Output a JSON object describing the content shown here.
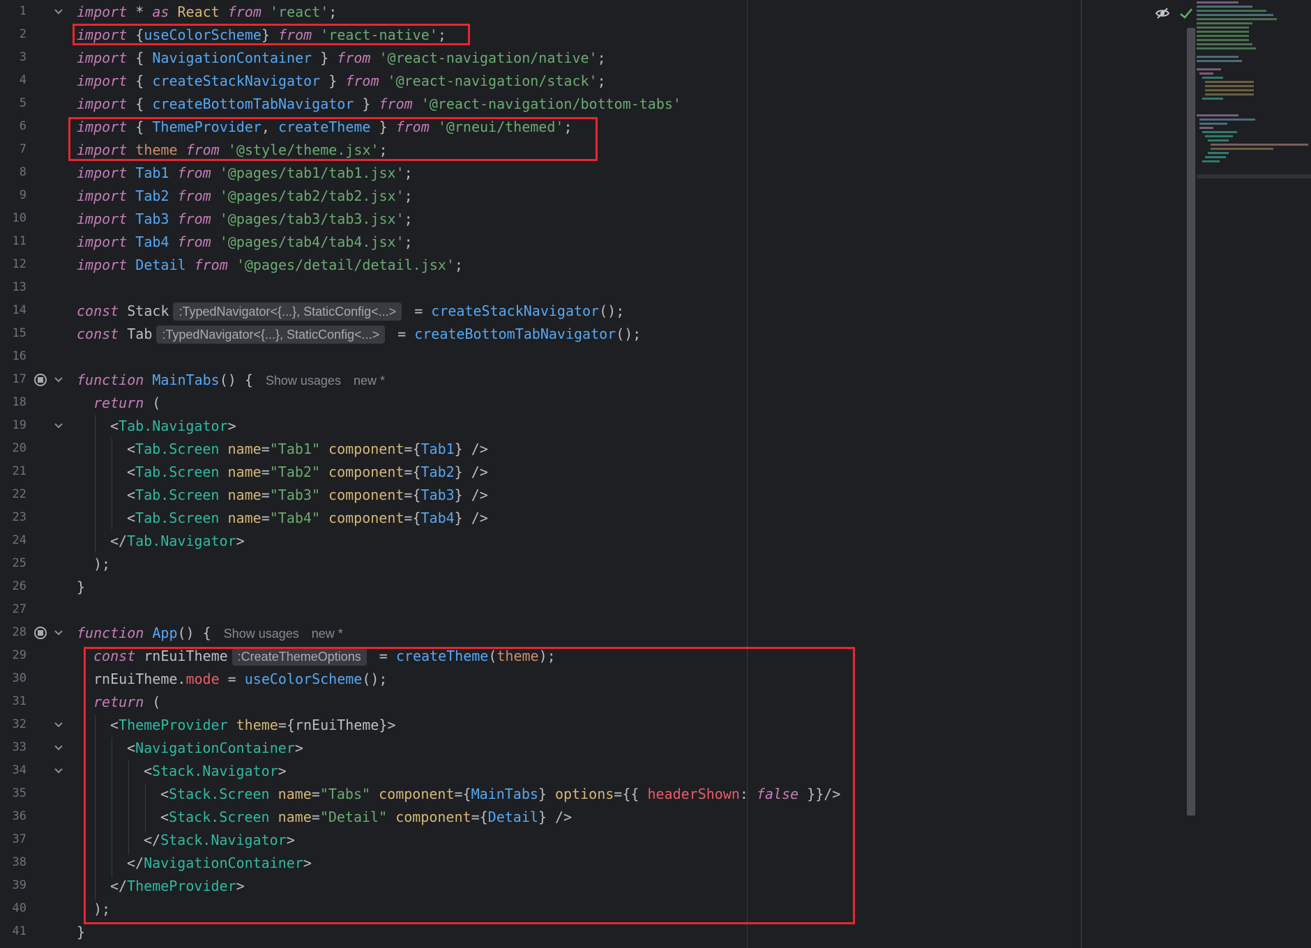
{
  "editor": {
    "line_numbers": [
      "1",
      "2",
      "3",
      "4",
      "5",
      "6",
      "7",
      "8",
      "9",
      "10",
      "11",
      "12",
      "13",
      "14",
      "15",
      "16",
      "17",
      "18",
      "19",
      "20",
      "21",
      "22",
      "23",
      "24",
      "25",
      "26",
      "27",
      "28",
      "29",
      "30",
      "31",
      "32",
      "33",
      "34",
      "35",
      "36",
      "37",
      "38",
      "39",
      "40",
      "41"
    ],
    "hints": {
      "stack_type": ":TypedNavigator<{...}, StaticConfig<...>",
      "tab_type": ":TypedNavigator<{...}, StaticConfig<...>",
      "theme_type": ":CreateThemeOptions"
    },
    "lens": {
      "show_usages": "Show usages",
      "new": "new *"
    }
  },
  "code": {
    "l1": [
      "import",
      " * ",
      "as",
      " ",
      "React",
      " ",
      "from",
      " ",
      "'react'",
      ";"
    ],
    "l2": [
      "import",
      " {",
      "useColorScheme",
      "} ",
      "from",
      " ",
      "'react-native'",
      ";"
    ],
    "l3": [
      "import",
      " { ",
      "NavigationContainer",
      " } ",
      "from",
      " ",
      "'@react-navigation/native'",
      ";"
    ],
    "l4": [
      "import",
      " { ",
      "createStackNavigator",
      " } ",
      "from",
      " ",
      "'@react-navigation/stack'",
      ";"
    ],
    "l5": [
      "import",
      " { ",
      "createBottomTabNavigator",
      " } ",
      "from",
      " ",
      "'@react-navigation/bottom-tabs'"
    ],
    "l6": [
      "import",
      " { ",
      "ThemeProvider",
      ", ",
      "createTheme",
      " } ",
      "from",
      " ",
      "'@rneui/themed'",
      ";"
    ],
    "l7": [
      "import",
      " ",
      "theme",
      " ",
      "from",
      " ",
      "'@style/theme.jsx'",
      ";"
    ],
    "l8": [
      "import",
      " ",
      "Tab1",
      " ",
      "from",
      " ",
      "'@pages/tab1/tab1.jsx'",
      ";"
    ],
    "l9": [
      "import",
      " ",
      "Tab2",
      " ",
      "from",
      " ",
      "'@pages/tab2/tab2.jsx'",
      ";"
    ],
    "l10": [
      "import",
      " ",
      "Tab3",
      " ",
      "from",
      " ",
      "'@pages/tab3/tab3.jsx'",
      ";"
    ],
    "l11": [
      "import",
      " ",
      "Tab4",
      " ",
      "from",
      " ",
      "'@pages/tab4/tab4.jsx'",
      ";"
    ],
    "l12": [
      "import",
      " ",
      "Detail",
      " ",
      "from",
      " ",
      "'@pages/detail/detail.jsx'",
      ";"
    ],
    "l14": [
      "const",
      " Stack",
      " = ",
      "createStackNavigator",
      "();"
    ],
    "l15": [
      "const",
      " Tab",
      " = ",
      "createBottomTabNavigator",
      "();"
    ],
    "l17": [
      "function",
      " ",
      "MainTabs",
      "() {"
    ],
    "l18": [
      "return",
      " ("
    ],
    "l19": [
      "<",
      "Tab.Navigator",
      ">"
    ],
    "tab_screens": [
      {
        "tag": "Tab.Screen",
        "name_attr": "name",
        "name_val": "\"Tab1\"",
        "comp_attr": "component",
        "comp_val": "Tab1"
      },
      {
        "tag": "Tab.Screen",
        "name_attr": "name",
        "name_val": "\"Tab2\"",
        "comp_attr": "component",
        "comp_val": "Tab2"
      },
      {
        "tag": "Tab.Screen",
        "name_attr": "name",
        "name_val": "\"Tab3\"",
        "comp_attr": "component",
        "comp_val": "Tab3"
      },
      {
        "tag": "Tab.Screen",
        "name_attr": "name",
        "name_val": "\"Tab4\"",
        "comp_attr": "component",
        "comp_val": "Tab4"
      }
    ],
    "l24": [
      "</",
      "Tab.Navigator",
      ">"
    ],
    "l25": ");",
    "l26": "}",
    "l28": [
      "function",
      " ",
      "App",
      "() {"
    ],
    "l29": [
      "const",
      " rnEuiTheme",
      " = ",
      "createTheme",
      "(",
      "theme",
      ");"
    ],
    "l30": [
      "rnEuiTheme.",
      "mode",
      " = ",
      "useColorScheme",
      "();"
    ],
    "l31": [
      "return",
      " ("
    ],
    "l32": [
      "<",
      "ThemeProvider",
      " ",
      "theme",
      "={rnEuiTheme}>"
    ],
    "l33": [
      "<",
      "NavigationContainer",
      ">"
    ],
    "l34": [
      "<",
      "Stack.Navigator",
      ">"
    ],
    "l35": [
      "<",
      "Stack.Screen",
      " ",
      "name",
      "=",
      "\"Tabs\"",
      " ",
      "component",
      "={",
      "MainTabs",
      "} ",
      "options",
      "={{ ",
      "headerShown",
      ": ",
      "false",
      " }}/>"
    ],
    "l36": [
      "<",
      "Stack.Screen",
      " ",
      "name",
      "=",
      "\"Detail\"",
      " ",
      "component",
      "={",
      "Detail",
      "} />"
    ],
    "l37": [
      "</",
      "Stack.Navigator",
      ">"
    ],
    "l38": [
      "</",
      "NavigationContainer",
      ">"
    ],
    "l39": [
      "</",
      "ThemeProvider",
      ">"
    ],
    "l40": ");",
    "l41": "}"
  },
  "colors": {
    "background": "#1e1f22",
    "keyword": "#c77dbb",
    "string": "#6aab73",
    "function": "#56a8f5",
    "jsx_tag": "#2fbaa3",
    "attribute": "#d5b778",
    "highlight_box": "#e8262f"
  },
  "icons": {
    "reader_mode": "eye-off-icon",
    "inspection_ok": "checkmark-icon",
    "run_gutter": "run-gutter-icon",
    "fold": "chevron-down-icon"
  }
}
